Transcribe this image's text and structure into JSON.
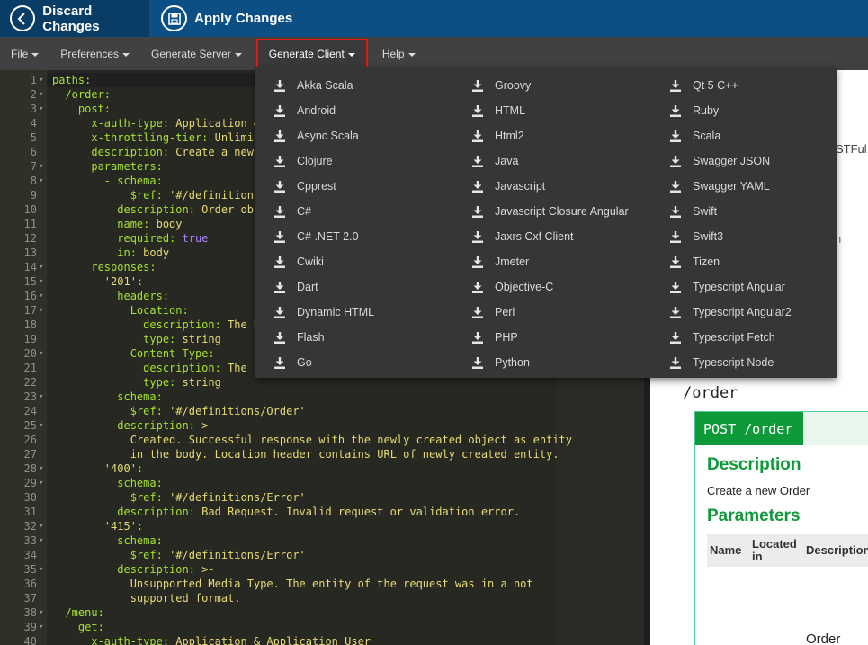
{
  "topbar": {
    "discard_label": "Discard Changes",
    "apply_label": "Apply Changes"
  },
  "menubar": {
    "file": "File",
    "preferences": "Preferences",
    "generate_server": "Generate Server",
    "generate_client": "Generate Client",
    "help": "Help"
  },
  "editor": {
    "lines": [
      {
        "n": "1",
        "fold": "▾",
        "parts": [
          [
            "k",
            "paths:"
          ]
        ]
      },
      {
        "n": "2",
        "fold": "▾",
        "parts": [
          [
            "w",
            "  "
          ],
          [
            "k",
            "/order:"
          ]
        ]
      },
      {
        "n": "3",
        "fold": "▾",
        "parts": [
          [
            "w",
            "    "
          ],
          [
            "k",
            "post:"
          ]
        ]
      },
      {
        "n": "4",
        "fold": "",
        "parts": [
          [
            "w",
            "      "
          ],
          [
            "k",
            "x-auth-type: "
          ],
          [
            "s",
            "Application &"
          ]
        ]
      },
      {
        "n": "5",
        "fold": "",
        "parts": [
          [
            "w",
            "      "
          ],
          [
            "k",
            "x-throttling-tier: "
          ],
          [
            "s",
            "Unlimite"
          ]
        ]
      },
      {
        "n": "6",
        "fold": "",
        "parts": [
          [
            "w",
            "      "
          ],
          [
            "k",
            "description: "
          ],
          [
            "s",
            "Create a new O"
          ]
        ]
      },
      {
        "n": "7",
        "fold": "▾",
        "parts": [
          [
            "w",
            "      "
          ],
          [
            "k",
            "parameters:"
          ]
        ]
      },
      {
        "n": "8",
        "fold": "▾",
        "parts": [
          [
            "w",
            "        "
          ],
          [
            "k",
            "- schema:"
          ]
        ]
      },
      {
        "n": "9",
        "fold": "",
        "parts": [
          [
            "w",
            "            "
          ],
          [
            "k",
            "$ref: "
          ],
          [
            "s",
            "'#/definitions/"
          ]
        ]
      },
      {
        "n": "10",
        "fold": "",
        "parts": [
          [
            "w",
            "          "
          ],
          [
            "k",
            "description: "
          ],
          [
            "s",
            "Order obje"
          ]
        ]
      },
      {
        "n": "11",
        "fold": "",
        "parts": [
          [
            "w",
            "          "
          ],
          [
            "k",
            "name: "
          ],
          [
            "s",
            "body"
          ]
        ]
      },
      {
        "n": "12",
        "fold": "",
        "parts": [
          [
            "w",
            "          "
          ],
          [
            "k",
            "required: "
          ],
          [
            "b",
            "true"
          ]
        ]
      },
      {
        "n": "13",
        "fold": "",
        "parts": [
          [
            "w",
            "          "
          ],
          [
            "k",
            "in: "
          ],
          [
            "s",
            "body"
          ]
        ]
      },
      {
        "n": "14",
        "fold": "▾",
        "parts": [
          [
            "w",
            "      "
          ],
          [
            "k",
            "responses:"
          ]
        ]
      },
      {
        "n": "15",
        "fold": "▾",
        "parts": [
          [
            "w",
            "        "
          ],
          [
            "s",
            "'201'"
          ],
          [
            "k",
            ":"
          ]
        ]
      },
      {
        "n": "16",
        "fold": "▾",
        "parts": [
          [
            "w",
            "          "
          ],
          [
            "k",
            "headers:"
          ]
        ]
      },
      {
        "n": "17",
        "fold": "▾",
        "parts": [
          [
            "w",
            "            "
          ],
          [
            "k",
            "Location:"
          ]
        ]
      },
      {
        "n": "18",
        "fold": "",
        "parts": [
          [
            "w",
            "              "
          ],
          [
            "k",
            "description: "
          ],
          [
            "s",
            "The UR"
          ]
        ]
      },
      {
        "n": "19",
        "fold": "",
        "parts": [
          [
            "w",
            "              "
          ],
          [
            "k",
            "type: "
          ],
          [
            "s",
            "string"
          ]
        ]
      },
      {
        "n": "20",
        "fold": "▾",
        "parts": [
          [
            "w",
            "            "
          ],
          [
            "k",
            "Content-Type:"
          ]
        ]
      },
      {
        "n": "21",
        "fold": "",
        "parts": [
          [
            "w",
            "              "
          ],
          [
            "k",
            "description: "
          ],
          [
            "s",
            "The co"
          ]
        ]
      },
      {
        "n": "22",
        "fold": "",
        "parts": [
          [
            "w",
            "              "
          ],
          [
            "k",
            "type: "
          ],
          [
            "s",
            "string"
          ]
        ]
      },
      {
        "n": "23",
        "fold": "▾",
        "parts": [
          [
            "w",
            "          "
          ],
          [
            "k",
            "schema:"
          ]
        ]
      },
      {
        "n": "24",
        "fold": "",
        "parts": [
          [
            "w",
            "            "
          ],
          [
            "k",
            "$ref: "
          ],
          [
            "s",
            "'#/definitions/Order'"
          ]
        ]
      },
      {
        "n": "25",
        "fold": "▾",
        "parts": [
          [
            "w",
            "          "
          ],
          [
            "k",
            "description: "
          ],
          [
            "s",
            ">-"
          ]
        ]
      },
      {
        "n": "26",
        "fold": "",
        "parts": [
          [
            "w",
            "            "
          ],
          [
            "s",
            "Created. Successful response with the newly created object as entity"
          ]
        ]
      },
      {
        "n": "27",
        "fold": "",
        "parts": [
          [
            "w",
            "            "
          ],
          [
            "s",
            "in the body. Location header contains URL of newly created entity."
          ]
        ]
      },
      {
        "n": "28",
        "fold": "▾",
        "parts": [
          [
            "w",
            "        "
          ],
          [
            "s",
            "'400'"
          ],
          [
            "k",
            ":"
          ]
        ]
      },
      {
        "n": "29",
        "fold": "▾",
        "parts": [
          [
            "w",
            "          "
          ],
          [
            "k",
            "schema:"
          ]
        ]
      },
      {
        "n": "30",
        "fold": "",
        "parts": [
          [
            "w",
            "            "
          ],
          [
            "k",
            "$ref: "
          ],
          [
            "s",
            "'#/definitions/Error'"
          ]
        ]
      },
      {
        "n": "31",
        "fold": "",
        "parts": [
          [
            "w",
            "          "
          ],
          [
            "k",
            "description: "
          ],
          [
            "s",
            "Bad Request. Invalid request or validation error."
          ]
        ]
      },
      {
        "n": "32",
        "fold": "▾",
        "parts": [
          [
            "w",
            "        "
          ],
          [
            "s",
            "'415'"
          ],
          [
            "k",
            ":"
          ]
        ]
      },
      {
        "n": "33",
        "fold": "▾",
        "parts": [
          [
            "w",
            "          "
          ],
          [
            "k",
            "schema:"
          ]
        ]
      },
      {
        "n": "34",
        "fold": "",
        "parts": [
          [
            "w",
            "            "
          ],
          [
            "k",
            "$ref: "
          ],
          [
            "s",
            "'#/definitions/Error'"
          ]
        ]
      },
      {
        "n": "35",
        "fold": "▾",
        "parts": [
          [
            "w",
            "          "
          ],
          [
            "k",
            "description: "
          ],
          [
            "s",
            ">-"
          ]
        ]
      },
      {
        "n": "36",
        "fold": "",
        "parts": [
          [
            "w",
            "            "
          ],
          [
            "s",
            "Unsupported Media Type. The entity of the request was in a not"
          ]
        ]
      },
      {
        "n": "37",
        "fold": "",
        "parts": [
          [
            "w",
            "            "
          ],
          [
            "s",
            "supported format."
          ]
        ]
      },
      {
        "n": "38",
        "fold": "▾",
        "parts": [
          [
            "w",
            "  "
          ],
          [
            "k",
            "/menu:"
          ]
        ]
      },
      {
        "n": "39",
        "fold": "▾",
        "parts": [
          [
            "w",
            "    "
          ],
          [
            "k",
            "get:"
          ]
        ]
      },
      {
        "n": "40",
        "fold": "",
        "parts": [
          [
            "w",
            "      "
          ],
          [
            "k",
            "x-auth-type: "
          ],
          [
            "s",
            "Application & Application User"
          ]
        ]
      }
    ]
  },
  "preview": {
    "fragment_stful": "STFul",
    "fragment_n": "n",
    "path_title": "/order",
    "op_method": "POST /order",
    "description_heading": "Description",
    "description_text": "Create a new Order",
    "parameters_heading": "Parameters",
    "col_name": "Name",
    "col_located_1": "Located",
    "col_located_2": "in",
    "col_description": "Description",
    "order_obj": "Order obje"
  },
  "generate_client_menu": {
    "columns": [
      [
        "Akka Scala",
        "Android",
        "Async Scala",
        "Clojure",
        "Cpprest",
        "C#",
        "C# .NET 2.0",
        "Cwiki",
        "Dart",
        "Dynamic HTML",
        "Flash",
        "Go"
      ],
      [
        "Groovy",
        "HTML",
        "Html2",
        "Java",
        "Javascript",
        "Javascript Closure Angular",
        "Jaxrs Cxf Client",
        "Jmeter",
        "Objective-C",
        "Perl",
        "PHP",
        "Python"
      ],
      [
        "Qt 5 C++",
        "Ruby",
        "Scala",
        "Swagger JSON",
        "Swagger YAML",
        "Swift",
        "Swift3",
        "Tizen",
        "Typescript Angular",
        "Typescript Angular2",
        "Typescript Fetch",
        "Typescript Node"
      ]
    ]
  },
  "colors": {
    "topbar": "#0b4f85",
    "highlight_border": "#e01a1a",
    "post_green": "#0f9a3a"
  },
  "icons": {
    "back": "chevron-left-icon",
    "save": "floppy-disk-icon",
    "download": "download-icon"
  }
}
